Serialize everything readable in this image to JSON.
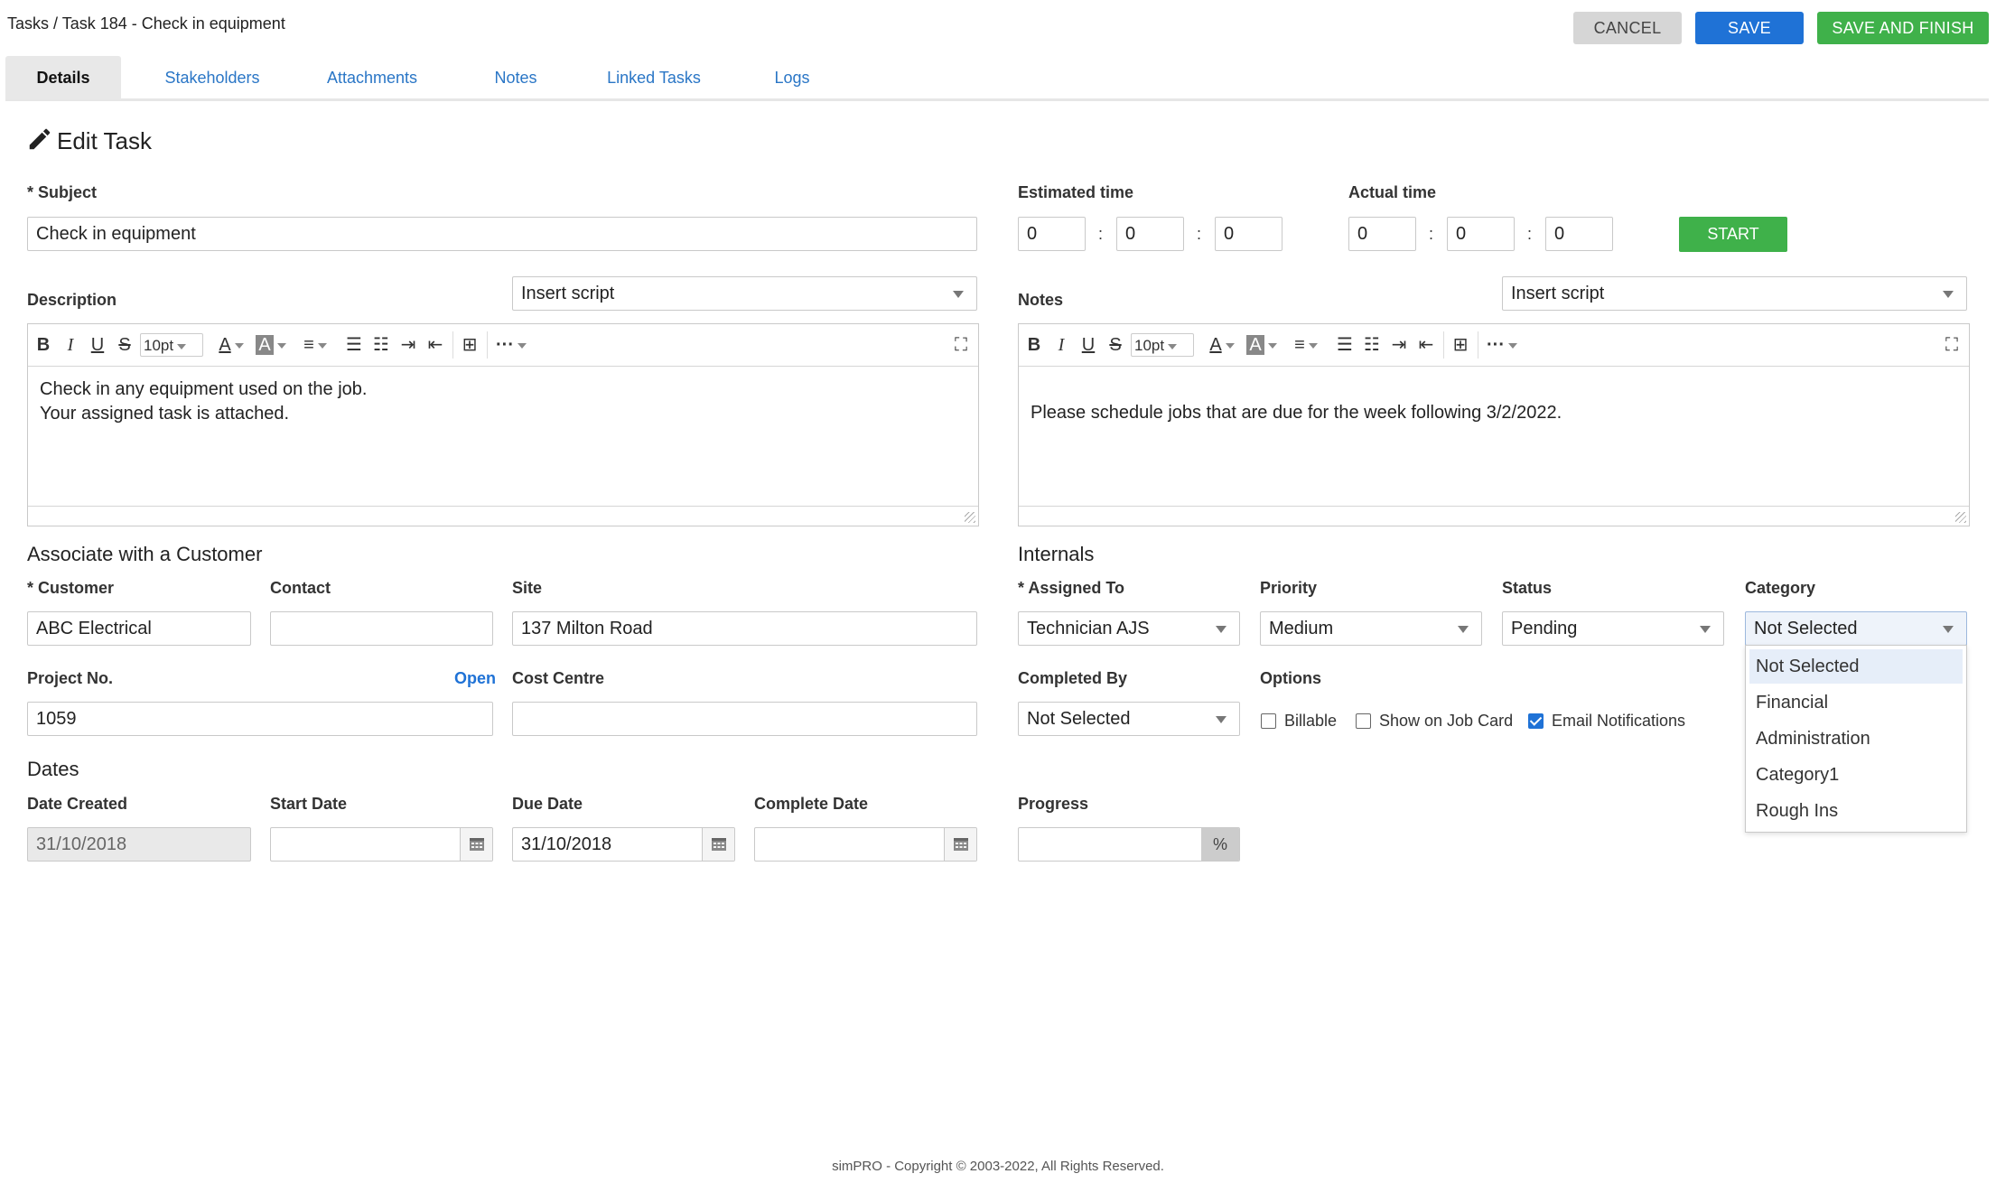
{
  "header": {
    "breadcrumb": "Tasks / Task 184 - Check in equipment",
    "cancel_label": "CANCEL",
    "save_label": "SAVE",
    "save_finish_label": "SAVE AND FINISH"
  },
  "tabs": [
    {
      "label": "Details",
      "active": true
    },
    {
      "label": "Stakeholders"
    },
    {
      "label": "Attachments"
    },
    {
      "label": "Notes"
    },
    {
      "label": "Linked Tasks"
    },
    {
      "label": "Logs"
    }
  ],
  "edit": {
    "title": "Edit Task",
    "subject_label": "Subject",
    "subject_value": "Check in equipment",
    "estimated_label": "Estimated time",
    "estimated": [
      "0",
      "0",
      "0"
    ],
    "actual_label": "Actual time",
    "actual": [
      "0",
      "0",
      "0"
    ],
    "start_label": "START",
    "description_label": "Description",
    "description_script": "Insert script",
    "description_lines": [
      "Check in any equipment used on the job.",
      "Your assigned task is attached."
    ],
    "notes_label": "Notes",
    "notes_script": "Insert script",
    "notes_text": "Please schedule jobs that are due for the week following 3/2/2022.",
    "font_size": "10pt"
  },
  "customer": {
    "section": "Associate with a Customer",
    "customer_label": "Customer",
    "customer_value": "ABC Electrical",
    "contact_label": "Contact",
    "contact_value": "",
    "site_label": "Site",
    "site_value": "137 Milton Road",
    "project_label": "Project No.",
    "project_link": "Open",
    "project_value": "1059",
    "cost_label": "Cost Centre",
    "cost_value": ""
  },
  "internals": {
    "section": "Internals",
    "assigned_label": "Assigned To",
    "assigned_value": "Technician AJS",
    "priority_label": "Priority",
    "priority_value": "Medium",
    "status_label": "Status",
    "status_value": "Pending",
    "category_label": "Category",
    "category_value": "Not Selected",
    "completed_label": "Completed By",
    "completed_value": "Not Selected",
    "options_label": "Options",
    "options": [
      {
        "label": "Billable",
        "checked": false
      },
      {
        "label": "Show on Job Card",
        "checked": false
      },
      {
        "label": "Email Notifications",
        "checked": true
      }
    ],
    "category_options": [
      "Not Selected",
      "Financial",
      "Administration",
      "Category1",
      "Rough Ins"
    ]
  },
  "dates": {
    "section": "Dates",
    "created_label": "Date Created",
    "created_value": "31/10/2018",
    "start_label": "Start Date",
    "start_value": "",
    "due_label": "Due Date",
    "due_value": "31/10/2018",
    "complete_label": "Complete Date",
    "complete_value": "",
    "progress_label": "Progress",
    "progress_value": "",
    "progress_unit": "%"
  },
  "footer": "simPRO - Copyright © 2003-2022, All Rights Reserved."
}
